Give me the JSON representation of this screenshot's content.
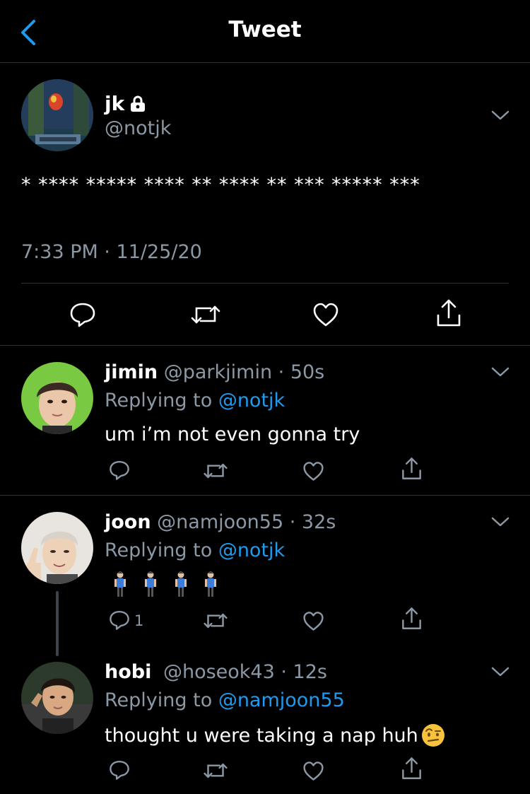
{
  "header": {
    "title": "Tweet",
    "back_icon": "chevron-left-icon",
    "accent": "#1d9bf0"
  },
  "main_tweet": {
    "name": "jk",
    "handle": "@notjk",
    "locked_icon": "lock-icon",
    "text": "* **** ***** **** ** **** ** *** ***** ***",
    "timestamp": "7:33 PM · 11/25/20",
    "actions": [
      "reply-icon",
      "retweet-icon",
      "like-icon",
      "share-icon"
    ]
  },
  "replies": [
    {
      "name": "jimin",
      "handle": "@parkjimin",
      "time": "50s",
      "replying_label": "Replying to",
      "replying_to": "@notjk",
      "text": "um i’m not even gonna try",
      "reply_count": ""
    },
    {
      "name": "joon",
      "handle": "@namjoon55",
      "time": "32s",
      "replying_label": "Replying to",
      "replying_to": "@notjk",
      "text": "",
      "emoji": "person-standing-emoji ×4",
      "reply_count": "1"
    },
    {
      "name": "hobi",
      "handle": "@hoseok43",
      "time": "12s",
      "replying_label": "Replying to",
      "replying_to": "@namjoon55",
      "text": "thought u were taking a nap huh",
      "emoji": "raised-eyebrow-emoji",
      "reply_count": ""
    }
  ],
  "colors": {
    "background": "#000000",
    "secondary_text": "#8b98a5",
    "link": "#1d9bf0",
    "divider": "#2f3336"
  }
}
